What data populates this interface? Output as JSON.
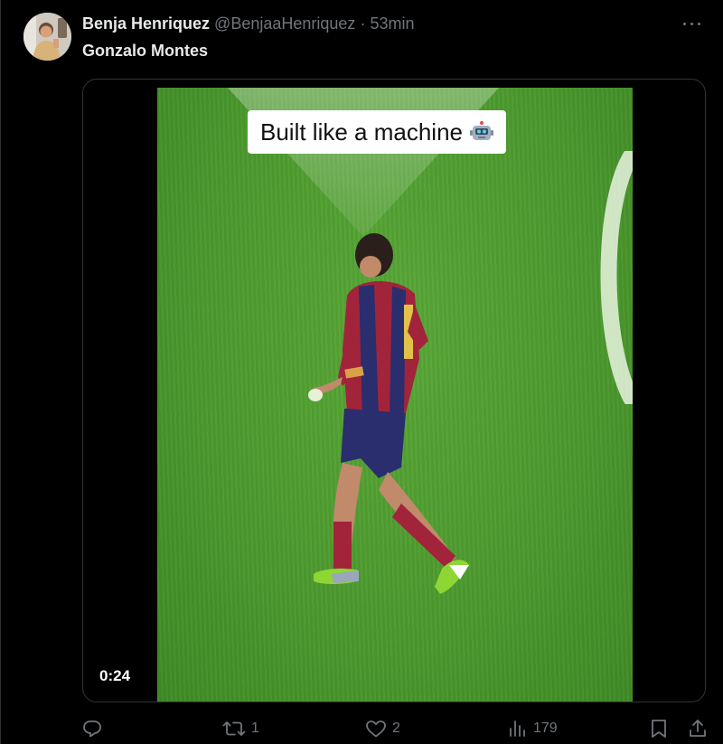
{
  "tweet": {
    "author": {
      "display_name": "Benja Henriquez",
      "handle": "@BenjaaHenriquez",
      "separator": "·",
      "timestamp": "53min"
    },
    "text": "Gonzalo Montes",
    "media": {
      "caption": "Built like a machine",
      "caption_emoji": "robot-icon",
      "duration": "0:24"
    },
    "actions": {
      "replies": "",
      "retweets": "1",
      "likes": "2",
      "views": "179"
    }
  },
  "colors": {
    "background": "#000000",
    "text_primary": "#e7e9ea",
    "text_secondary": "#71767b",
    "border": "#2f3336",
    "pitch_green": "#4c9a2e"
  }
}
